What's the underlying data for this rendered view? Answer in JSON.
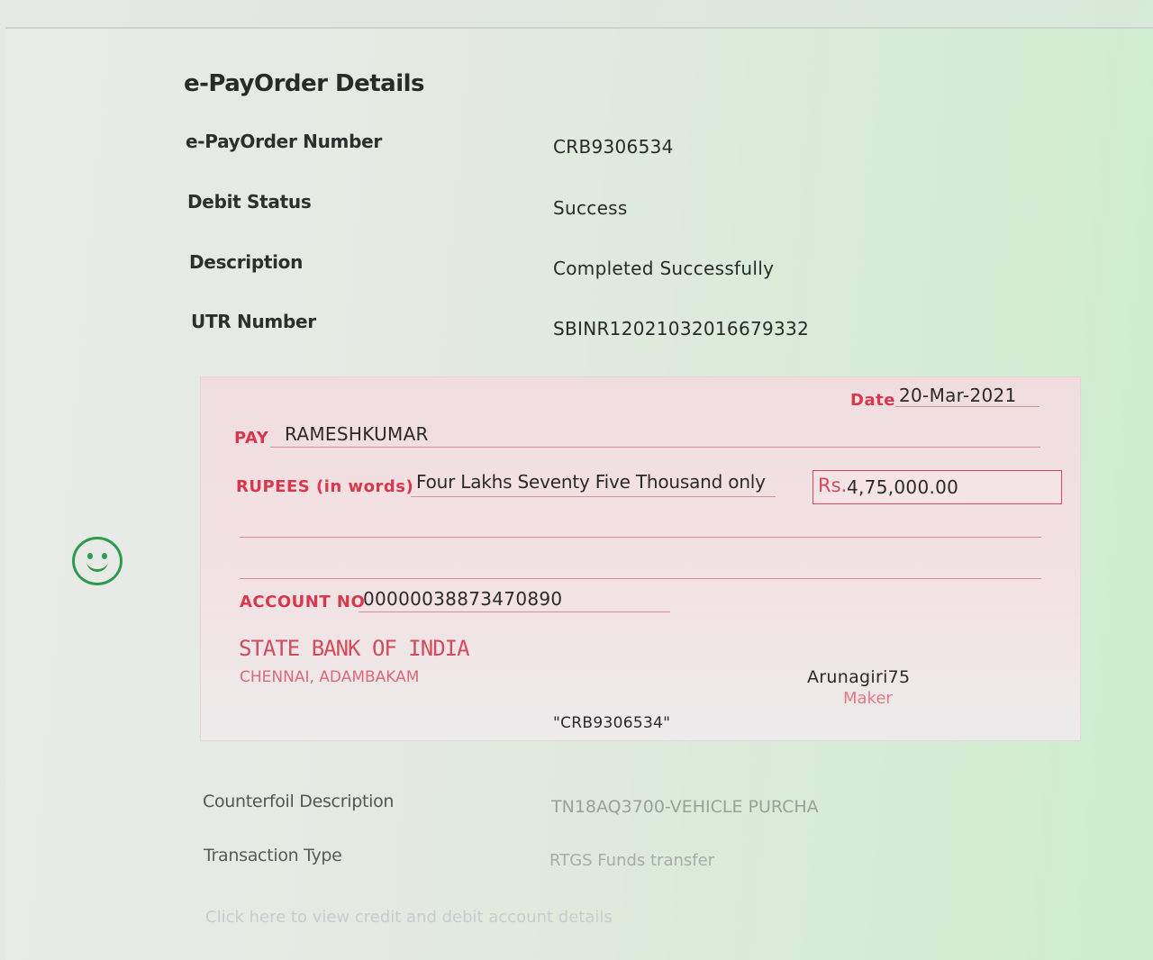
{
  "details": {
    "heading": "e-PayOrder Details",
    "rows": [
      {
        "label": "e-PayOrder Number",
        "value": "CRB9306534"
      },
      {
        "label": "Debit Status",
        "value": "Success"
      },
      {
        "label": "Description",
        "value": "Completed Successfully"
      },
      {
        "label": "UTR Number",
        "value": "SBINR12021032016679332"
      }
    ]
  },
  "cheque": {
    "date_label": "Date",
    "date_value": "20-Mar-2021",
    "pay_label": "PAY",
    "payee": "RAMESHKUMAR",
    "rupees_label": "RUPEES (in words)",
    "amount_words": "Four Lakhs Seventy Five Thousand only",
    "rs_label": "Rs.",
    "amount_figure": "4,75,000.00",
    "account_label": "ACCOUNT NO",
    "account_number": "00000038873470890",
    "bank_name": "STATE BANK OF INDIA",
    "branch": "CHENNAI, ADAMBAKAM",
    "signer_name": "Arunagiri75",
    "signer_role": "Maker",
    "reference": "\"CRB9306534\""
  },
  "footer": {
    "rows": [
      {
        "label": "Counterfoil Description",
        "value": "TN18AQ3700-VEHICLE PURCHA"
      },
      {
        "label": "Transaction Type",
        "value": "RTGS Funds transfer"
      }
    ],
    "link_text": "Click here to view credit and debit account details"
  },
  "colors": {
    "accent_red": "#d8384c",
    "success_green": "#2e9b4d"
  },
  "icons": {
    "status_icon": "smiley-face-icon"
  }
}
